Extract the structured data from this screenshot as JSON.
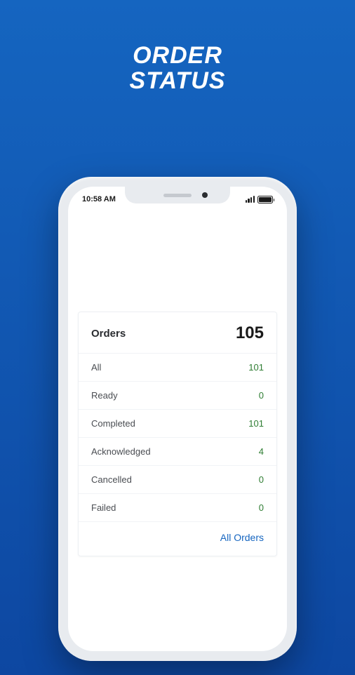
{
  "page": {
    "title_line1": "ORDER",
    "title_line2": "STATUS"
  },
  "status_bar": {
    "time": "10:58 AM"
  },
  "card": {
    "header_label": "Orders",
    "header_value": "105",
    "rows": [
      {
        "label": "All",
        "value": "101"
      },
      {
        "label": "Ready",
        "value": "0"
      },
      {
        "label": "Completed",
        "value": "101"
      },
      {
        "label": "Acknowledged",
        "value": "4"
      },
      {
        "label": "Cancelled",
        "value": "0"
      },
      {
        "label": "Failed",
        "value": "0"
      }
    ],
    "footer_link": "All Orders"
  }
}
